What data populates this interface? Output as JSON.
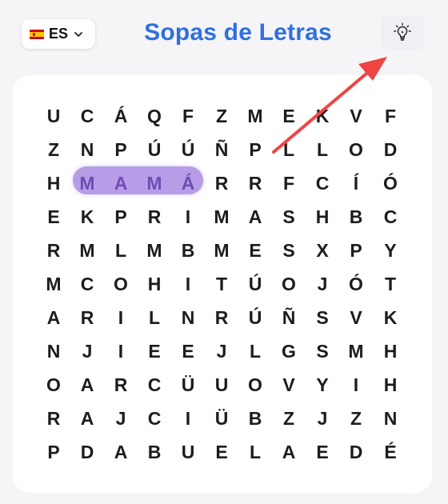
{
  "header": {
    "language_code": "ES",
    "title": "Sopas de Letras"
  },
  "icons": {
    "flag": "spain-flag-icon",
    "dropdown": "chevron-down-icon",
    "hint": "lightbulb-icon",
    "annotation": "red-arrow-icon"
  },
  "colors": {
    "title": "#2f6fe0",
    "highlight": "#b79de8",
    "found_letters": "#6f4db3",
    "arrow": "#ef4444"
  },
  "grid": {
    "rows": [
      [
        "U",
        "C",
        "Á",
        "Q",
        "F",
        "Z",
        "M",
        "E",
        "K",
        "V",
        "F"
      ],
      [
        "Z",
        "N",
        "P",
        "Ú",
        "Ú",
        "Ñ",
        "P",
        "L",
        "L",
        "O",
        "D"
      ],
      [
        "H",
        "M",
        "A",
        "M",
        "Á",
        "R",
        "R",
        "F",
        "C",
        "Í",
        "Ó"
      ],
      [
        "E",
        "K",
        "P",
        "R",
        "I",
        "M",
        "A",
        "S",
        "H",
        "B",
        "C"
      ],
      [
        "R",
        "M",
        "L",
        "M",
        "B",
        "M",
        "E",
        "S",
        "X",
        "P",
        "Y"
      ],
      [
        "M",
        "C",
        "O",
        "H",
        "I",
        "T",
        "Ú",
        "O",
        "J",
        "Ó",
        "T"
      ],
      [
        "A",
        "R",
        "I",
        "L",
        "N",
        "R",
        "Ú",
        "Ñ",
        "S",
        "V",
        "K"
      ],
      [
        "N",
        "J",
        "I",
        "E",
        "E",
        "J",
        "L",
        "G",
        "S",
        "M",
        "H"
      ],
      [
        "O",
        "A",
        "R",
        "C",
        "Ü",
        "U",
        "O",
        "V",
        "Y",
        "I",
        "H"
      ],
      [
        "R",
        "A",
        "J",
        "C",
        "I",
        "Ü",
        "B",
        "Z",
        "J",
        "Z",
        "N"
      ],
      [
        "P",
        "D",
        "A",
        "B",
        "U",
        "E",
        "L",
        "A",
        "E",
        "D",
        "É"
      ]
    ],
    "found_word": "MAMÁ"
  }
}
